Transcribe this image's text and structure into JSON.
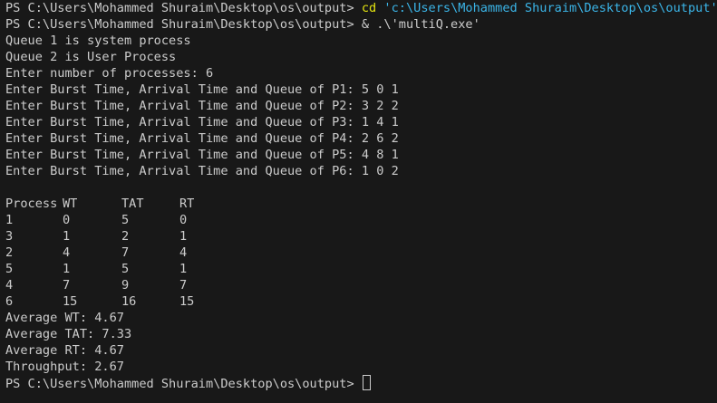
{
  "terminal": {
    "cmd1": {
      "prompt": "PS C:\\Users\\Mohammed Shuraim\\Desktop\\os\\output>",
      "command": "cd",
      "argument": "'c:\\Users\\Mohammed Shuraim\\Desktop\\os\\output'"
    },
    "cmd2": {
      "prompt": "PS C:\\Users\\Mohammed Shuraim\\Desktop\\os\\output>",
      "command": "&",
      "argument": ".\\'multiQ.exe'"
    },
    "output": [
      "Queue 1 is system process",
      "Queue 2 is User Process",
      "Enter number of processes: 6",
      "Enter Burst Time, Arrival Time and Queue of P1: 5 0 1",
      "Enter Burst Time, Arrival Time and Queue of P2: 3 2 2",
      "Enter Burst Time, Arrival Time and Queue of P3: 1 4 1",
      "Enter Burst Time, Arrival Time and Queue of P4: 2 6 2",
      "Enter Burst Time, Arrival Time and Queue of P5: 4 8 1",
      "Enter Burst Time, Arrival Time and Queue of P6: 1 0 2"
    ],
    "table": {
      "headers": [
        "Process",
        "WT",
        "TAT",
        "RT"
      ],
      "rows": [
        [
          "1",
          "0",
          "5",
          "0"
        ],
        [
          "3",
          "1",
          "2",
          "1"
        ],
        [
          "2",
          "4",
          "7",
          "4"
        ],
        [
          "5",
          "1",
          "5",
          "1"
        ],
        [
          "4",
          "7",
          "9",
          "7"
        ],
        [
          "6",
          "15",
          "16",
          "15"
        ]
      ]
    },
    "summary": [
      "Average WT: 4.67",
      "Average TAT: 7.33",
      "Average RT: 4.67",
      "Throughput: 2.67"
    ],
    "final_prompt": "PS C:\\Users\\Mohammed Shuraim\\Desktop\\os\\output>"
  },
  "colors": {
    "background": "#181818",
    "foreground": "#cccccc",
    "command": "#e5e510",
    "string": "#3bb5e8"
  }
}
